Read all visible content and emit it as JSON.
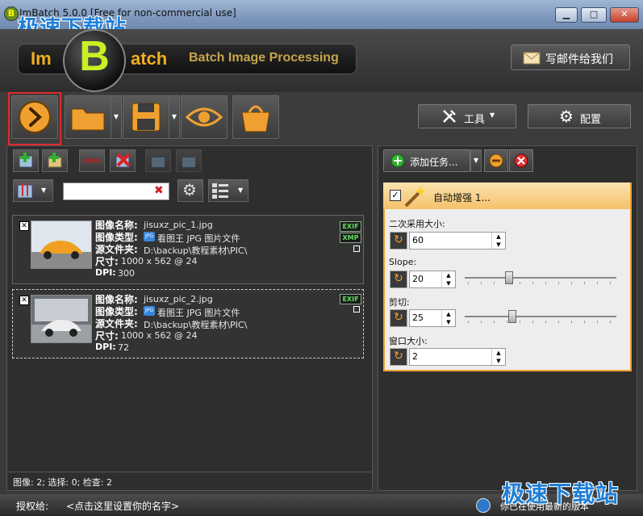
{
  "window": {
    "title": "ImBatch 5.0.0 [Free for non-commercial use]",
    "watermark": "极速下载站",
    "minimize": "▁",
    "maximize": "□",
    "close": "✕"
  },
  "header": {
    "logo_im": "Im",
    "logo_b": "B",
    "logo_atch": "atch",
    "tagline": "Batch Image Processing",
    "email_button": "写邮件给我们"
  },
  "toolbar": {
    "tools_label": "工具",
    "config_label": "配置",
    "dropdown_arrow": "▼"
  },
  "left": {
    "images": [
      {
        "name_label": "图像名称:",
        "name": "jisuxz_pic_1.jpg",
        "type_label": "图像类型:",
        "type_icon": "JPG",
        "type": "看图王 JPG 图片文件",
        "folder_label": "源文件夹:",
        "folder": "D:\\backup\\教程素材\\PIC\\",
        "size_label": "尺寸:",
        "size": "1000 x 562 @ 24",
        "dpi_label": "DPI:",
        "dpi": "300",
        "badges": [
          "EXIF",
          "XMP"
        ],
        "checked": "✕"
      },
      {
        "name_label": "图像名称:",
        "name": "jisuxz_pic_2.jpg",
        "type_label": "图像类型:",
        "type_icon": "JPG",
        "type": "看图王 JPG 图片文件",
        "folder_label": "源文件夹:",
        "folder": "D:\\backup\\教程素材\\PIC\\",
        "size_label": "尺寸:",
        "size": "1000 x 562 @ 24",
        "dpi_label": "DPI:",
        "dpi": "72",
        "badges": [
          "EXIF"
        ],
        "checked": "✕"
      }
    ],
    "status": "图像: 2; 选择: 0; 检查: 2"
  },
  "right": {
    "add_task": "添加任务...",
    "task_title": "自动增强 1...",
    "params": [
      {
        "label": "二次采用大小:",
        "value": "60"
      },
      {
        "label": "Slope:",
        "value": "20",
        "slider": 0.28
      },
      {
        "label": "剪切:",
        "value": "25",
        "slider": 0.3
      },
      {
        "label": "窗口大小:",
        "value": "2"
      }
    ]
  },
  "footer": {
    "license_label": "授权给:",
    "license_value": "<点击这里设置你的名字>",
    "version_status": "你已在使用最新的版本",
    "watermark": "极速下载站"
  },
  "colors": {
    "accent": "#f0a030",
    "panel": "#2e2e2e",
    "logo_green": "#c8f025"
  }
}
